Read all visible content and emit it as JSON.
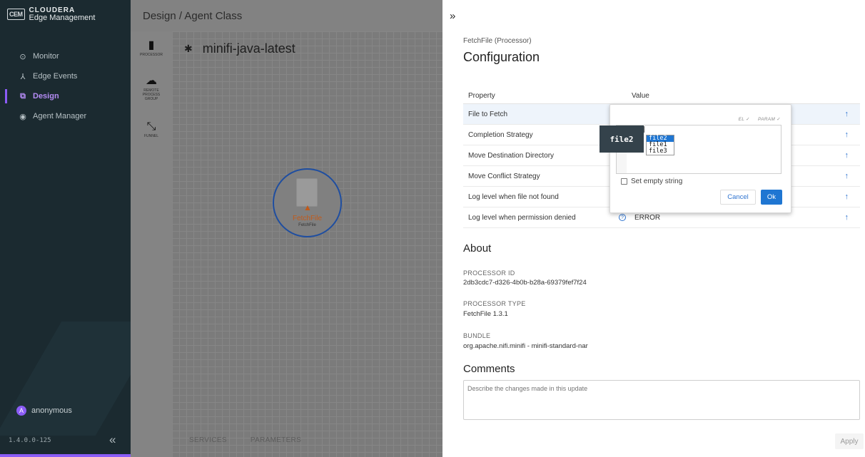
{
  "brand": {
    "logo": "CEM",
    "line1": "CLOUDERA",
    "line2": "Edge Management"
  },
  "nav": [
    {
      "label": "Monitor",
      "icon": "⊙"
    },
    {
      "label": "Edge Events",
      "icon": "⅄"
    },
    {
      "label": "Design",
      "icon": "⧉"
    },
    {
      "label": "Agent Manager",
      "icon": "◉"
    }
  ],
  "user": {
    "initial": "A",
    "name": "anonymous"
  },
  "version": "1.4.0.0-125",
  "collapse_icon": "«",
  "canvas": {
    "breadcrumb": "Design / Agent Class",
    "flow_name": "minifi-java-latest",
    "palette": {
      "processor": "PROCESSOR",
      "rpg": "REMOTE PROCESS GROUP",
      "funnel": "FUNNEL"
    },
    "node": {
      "name": "FetchFile",
      "type": "FetchFile"
    },
    "tabs": {
      "services": "SERVICES",
      "parameters": "PARAMETERS"
    }
  },
  "panel": {
    "expand_icon": "»",
    "processor_label": "FetchFile (Processor)",
    "title": "Configuration",
    "col_property": "Property",
    "col_value": "Value",
    "rows": [
      {
        "name": "File to Fetch",
        "value": ""
      },
      {
        "name": "Completion Strategy",
        "value": ""
      },
      {
        "name": "Move Destination Directory",
        "value": ""
      },
      {
        "name": "Move Conflict Strategy",
        "value": ""
      },
      {
        "name": "Log level when file not found",
        "value": ""
      },
      {
        "name": "Log level when permission denied",
        "value": "ERROR"
      }
    ],
    "about_title": "About",
    "processor_id_label": "PROCESSOR ID",
    "processor_id": "2db3cdc7-d326-4b0b-b28a-69379fef7f24",
    "processor_type_label": "PROCESSOR TYPE",
    "processor_type": "FetchFile 1.3.1",
    "bundle_label": "BUNDLE",
    "bundle": "org.apache.nifi.minifi - minifi-standard-nar",
    "comments_title": "Comments",
    "comments_placeholder": "Describe the changes made in this update",
    "apply_label": "Apply"
  },
  "editor": {
    "flag_el": "EL ✓",
    "flag_param": "PARAM ✓",
    "text": "",
    "set_empty_label": "Set empty string",
    "cancel_label": "Cancel",
    "ok_label": "Ok",
    "suggestions": [
      "file2",
      "file1",
      "file3"
    ],
    "tooltip": "file2",
    "caret": "|"
  }
}
